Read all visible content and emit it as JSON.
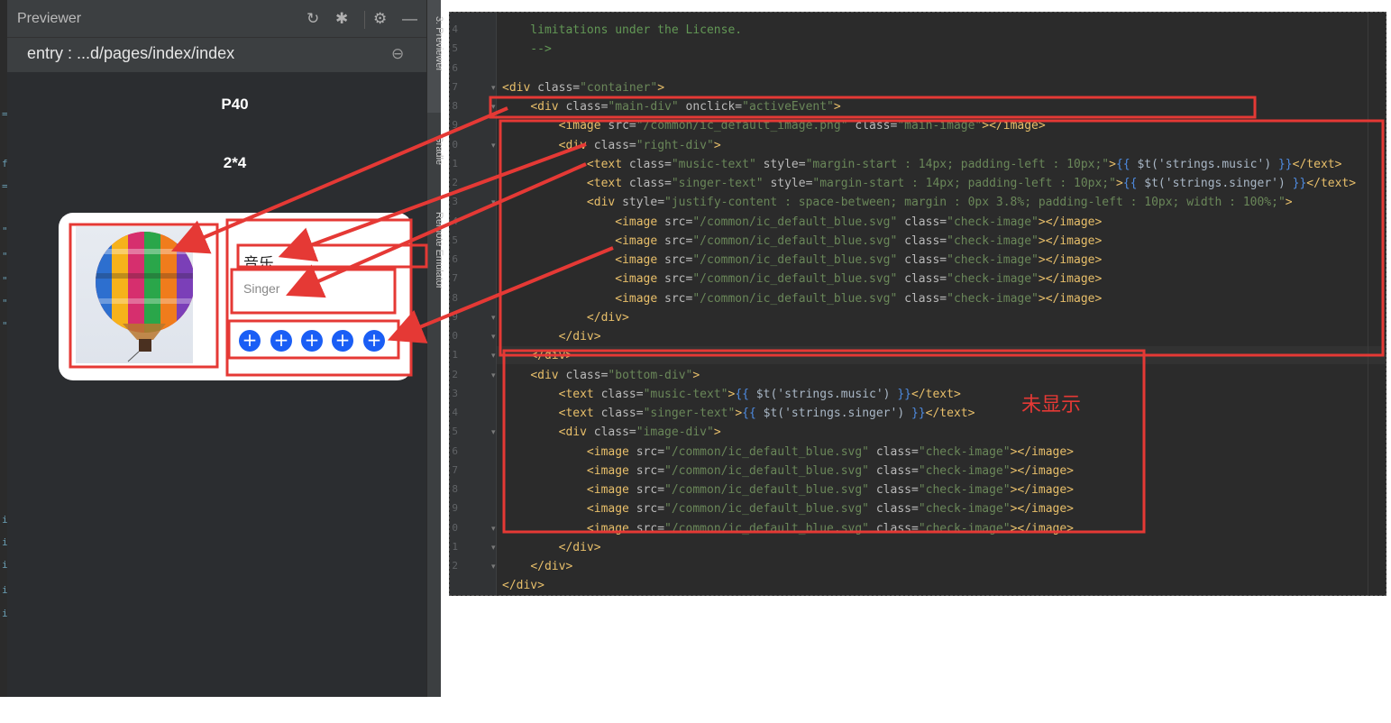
{
  "previewer": {
    "title": "Previewer",
    "entry": "entry : ...d/pages/index/index",
    "device_label": "P40",
    "size_label": "2*4",
    "card": {
      "music": "音乐",
      "singer": "Singer",
      "buttons": [
        "+",
        "+",
        "+",
        "+",
        "+"
      ]
    },
    "icons": {
      "refresh": "refresh-icon",
      "debug": "debug-bug-icon",
      "settings": "gear-icon",
      "minimize": "minimize-icon",
      "zoom_out": "zoom-out-icon"
    }
  },
  "side_tools": [
    "3: Previewer",
    "Gradle",
    "Remote Emulator"
  ],
  "editor": {
    "line_numbers": [
      "4",
      "5",
      "6",
      "7",
      "8",
      "9",
      "0",
      "1",
      "2",
      "3",
      "4",
      "5",
      "6",
      "7",
      "8",
      "9",
      "0",
      "1",
      "2",
      "3",
      "4",
      "5",
      "6",
      "7",
      "8",
      "9",
      "0",
      "1",
      "2"
    ],
    "lines": [
      [
        {
          "c": "t-com",
          "t": "    limitations under the License."
        }
      ],
      [
        {
          "c": "t-com",
          "t": "    -->"
        }
      ],
      [
        {
          "c": "t-txt",
          "t": ""
        }
      ],
      [
        {
          "c": "t-tag",
          "t": "<div "
        },
        {
          "c": "t-attr",
          "t": "class="
        },
        {
          "c": "t-val",
          "t": "\"container\""
        },
        {
          "c": "t-tag",
          "t": ">"
        }
      ],
      [
        {
          "c": "t-txt",
          "t": "    "
        },
        {
          "c": "t-tag",
          "t": "<div "
        },
        {
          "c": "t-attr",
          "t": "class="
        },
        {
          "c": "t-val",
          "t": "\"main-div\" "
        },
        {
          "c": "t-attr",
          "t": "onclick="
        },
        {
          "c": "t-val",
          "t": "\"activeEvent\""
        },
        {
          "c": "t-tag",
          "t": ">"
        }
      ],
      [
        {
          "c": "t-txt",
          "t": "        "
        },
        {
          "c": "t-tag",
          "t": "<image "
        },
        {
          "c": "t-attr",
          "t": "src="
        },
        {
          "c": "t-val",
          "t": "\"/common/ic_default_image.png\" "
        },
        {
          "c": "t-attr",
          "t": "class="
        },
        {
          "c": "t-val",
          "t": "\"main-image\""
        },
        {
          "c": "t-tag",
          "t": "></image>"
        }
      ],
      [
        {
          "c": "t-txt",
          "t": "        "
        },
        {
          "c": "t-tag",
          "t": "<div "
        },
        {
          "c": "t-attr",
          "t": "class="
        },
        {
          "c": "t-val",
          "t": "\"right-div\""
        },
        {
          "c": "t-tag",
          "t": ">"
        }
      ],
      [
        {
          "c": "t-txt",
          "t": "            "
        },
        {
          "c": "t-tag",
          "t": "<text "
        },
        {
          "c": "t-attr",
          "t": "class="
        },
        {
          "c": "t-val",
          "t": "\"music-text\" "
        },
        {
          "c": "t-attr",
          "t": "style="
        },
        {
          "c": "t-val",
          "t": "\"margin-start : 14px; padding-left : 10px;\""
        },
        {
          "c": "t-tag",
          "t": ">"
        },
        {
          "c": "t-br",
          "t": "{{ "
        },
        {
          "c": "t-txt",
          "t": "$t('strings.music') "
        },
        {
          "c": "t-br",
          "t": "}}"
        },
        {
          "c": "t-tag",
          "t": "</text>"
        }
      ],
      [
        {
          "c": "t-txt",
          "t": "            "
        },
        {
          "c": "t-tag",
          "t": "<text "
        },
        {
          "c": "t-attr",
          "t": "class="
        },
        {
          "c": "t-val",
          "t": "\"singer-text\" "
        },
        {
          "c": "t-attr",
          "t": "style="
        },
        {
          "c": "t-val",
          "t": "\"margin-start : 14px; padding-left : 10px;\""
        },
        {
          "c": "t-tag",
          "t": ">"
        },
        {
          "c": "t-br",
          "t": "{{ "
        },
        {
          "c": "t-txt",
          "t": "$t('strings.singer') "
        },
        {
          "c": "t-br",
          "t": "}}"
        },
        {
          "c": "t-tag",
          "t": "</text>"
        }
      ],
      [
        {
          "c": "t-txt",
          "t": "            "
        },
        {
          "c": "t-tag",
          "t": "<div "
        },
        {
          "c": "t-attr",
          "t": "style="
        },
        {
          "c": "t-val",
          "t": "\"justify-content : space-between; margin : 0px 3.8%; padding-left : 10px; width : 100%;\""
        },
        {
          "c": "t-tag",
          "t": ">"
        }
      ],
      [
        {
          "c": "t-txt",
          "t": "                "
        },
        {
          "c": "t-tag",
          "t": "<image "
        },
        {
          "c": "t-attr",
          "t": "src="
        },
        {
          "c": "t-val",
          "t": "\"/common/ic_default_blue.svg\" "
        },
        {
          "c": "t-attr",
          "t": "class="
        },
        {
          "c": "t-val",
          "t": "\"check-image\""
        },
        {
          "c": "t-tag",
          "t": "></image>"
        }
      ],
      [
        {
          "c": "t-txt",
          "t": "                "
        },
        {
          "c": "t-tag",
          "t": "<image "
        },
        {
          "c": "t-attr",
          "t": "src="
        },
        {
          "c": "t-val",
          "t": "\"/common/ic_default_blue.svg\" "
        },
        {
          "c": "t-attr",
          "t": "class="
        },
        {
          "c": "t-val",
          "t": "\"check-image\""
        },
        {
          "c": "t-tag",
          "t": "></image>"
        }
      ],
      [
        {
          "c": "t-txt",
          "t": "                "
        },
        {
          "c": "t-tag",
          "t": "<image "
        },
        {
          "c": "t-attr",
          "t": "src="
        },
        {
          "c": "t-val",
          "t": "\"/common/ic_default_blue.svg\" "
        },
        {
          "c": "t-attr",
          "t": "class="
        },
        {
          "c": "t-val",
          "t": "\"check-image\""
        },
        {
          "c": "t-tag",
          "t": "></image>"
        }
      ],
      [
        {
          "c": "t-txt",
          "t": "                "
        },
        {
          "c": "t-tag",
          "t": "<image "
        },
        {
          "c": "t-attr",
          "t": "src="
        },
        {
          "c": "t-val",
          "t": "\"/common/ic_default_blue.svg\" "
        },
        {
          "c": "t-attr",
          "t": "class="
        },
        {
          "c": "t-val",
          "t": "\"check-image\""
        },
        {
          "c": "t-tag",
          "t": "></image>"
        }
      ],
      [
        {
          "c": "t-txt",
          "t": "                "
        },
        {
          "c": "t-tag",
          "t": "<image "
        },
        {
          "c": "t-attr",
          "t": "src="
        },
        {
          "c": "t-val",
          "t": "\"/common/ic_default_blue.svg\" "
        },
        {
          "c": "t-attr",
          "t": "class="
        },
        {
          "c": "t-val",
          "t": "\"check-image\""
        },
        {
          "c": "t-tag",
          "t": "></image>"
        }
      ],
      [
        {
          "c": "t-txt",
          "t": "            "
        },
        {
          "c": "t-tag",
          "t": "</div>"
        }
      ],
      [
        {
          "c": "t-txt",
          "t": "        "
        },
        {
          "c": "t-tag",
          "t": "</div>"
        }
      ],
      [
        {
          "c": "t-txt",
          "t": "    "
        },
        {
          "c": "t-tag",
          "t": "</div>"
        }
      ],
      [
        {
          "c": "t-txt",
          "t": "    "
        },
        {
          "c": "t-tag",
          "t": "<div "
        },
        {
          "c": "t-attr",
          "t": "class="
        },
        {
          "c": "t-val",
          "t": "\"bottom-div\""
        },
        {
          "c": "t-tag",
          "t": ">"
        }
      ],
      [
        {
          "c": "t-txt",
          "t": "        "
        },
        {
          "c": "t-tag",
          "t": "<text "
        },
        {
          "c": "t-attr",
          "t": "class="
        },
        {
          "c": "t-val",
          "t": "\"music-text\""
        },
        {
          "c": "t-tag",
          "t": ">"
        },
        {
          "c": "t-br",
          "t": "{{ "
        },
        {
          "c": "t-txt",
          "t": "$t('strings.music') "
        },
        {
          "c": "t-br",
          "t": "}}"
        },
        {
          "c": "t-tag",
          "t": "</text>"
        }
      ],
      [
        {
          "c": "t-txt",
          "t": "        "
        },
        {
          "c": "t-tag",
          "t": "<text "
        },
        {
          "c": "t-attr",
          "t": "class="
        },
        {
          "c": "t-val",
          "t": "\"singer-text\""
        },
        {
          "c": "t-tag",
          "t": ">"
        },
        {
          "c": "t-br",
          "t": "{{ "
        },
        {
          "c": "t-txt",
          "t": "$t('strings.singer') "
        },
        {
          "c": "t-br",
          "t": "}}"
        },
        {
          "c": "t-tag",
          "t": "</text>"
        }
      ],
      [
        {
          "c": "t-txt",
          "t": "        "
        },
        {
          "c": "t-tag",
          "t": "<div "
        },
        {
          "c": "t-attr",
          "t": "class="
        },
        {
          "c": "t-val",
          "t": "\"image-div\""
        },
        {
          "c": "t-tag",
          "t": ">"
        }
      ],
      [
        {
          "c": "t-txt",
          "t": "            "
        },
        {
          "c": "t-tag",
          "t": "<image "
        },
        {
          "c": "t-attr",
          "t": "src="
        },
        {
          "c": "t-val",
          "t": "\"/common/ic_default_blue.svg\" "
        },
        {
          "c": "t-attr",
          "t": "class="
        },
        {
          "c": "t-val",
          "t": "\"check-image\""
        },
        {
          "c": "t-tag",
          "t": "></image>"
        }
      ],
      [
        {
          "c": "t-txt",
          "t": "            "
        },
        {
          "c": "t-tag",
          "t": "<image "
        },
        {
          "c": "t-attr",
          "t": "src="
        },
        {
          "c": "t-val",
          "t": "\"/common/ic_default_blue.svg\" "
        },
        {
          "c": "t-attr",
          "t": "class="
        },
        {
          "c": "t-val",
          "t": "\"check-image\""
        },
        {
          "c": "t-tag",
          "t": "></image>"
        }
      ],
      [
        {
          "c": "t-txt",
          "t": "            "
        },
        {
          "c": "t-tag",
          "t": "<image "
        },
        {
          "c": "t-attr",
          "t": "src="
        },
        {
          "c": "t-val",
          "t": "\"/common/ic_default_blue.svg\" "
        },
        {
          "c": "t-attr",
          "t": "class="
        },
        {
          "c": "t-val",
          "t": "\"check-image\""
        },
        {
          "c": "t-tag",
          "t": "></image>"
        }
      ],
      [
        {
          "c": "t-txt",
          "t": "            "
        },
        {
          "c": "t-tag",
          "t": "<image "
        },
        {
          "c": "t-attr",
          "t": "src="
        },
        {
          "c": "t-val",
          "t": "\"/common/ic_default_blue.svg\" "
        },
        {
          "c": "t-attr",
          "t": "class="
        },
        {
          "c": "t-val",
          "t": "\"check-image\""
        },
        {
          "c": "t-tag",
          "t": "></image>"
        }
      ],
      [
        {
          "c": "t-txt",
          "t": "            "
        },
        {
          "c": "t-tag",
          "t": "<image "
        },
        {
          "c": "t-attr",
          "t": "src="
        },
        {
          "c": "t-val",
          "t": "\"/common/ic_default_blue.svg\" "
        },
        {
          "c": "t-attr",
          "t": "class="
        },
        {
          "c": "t-val",
          "t": "\"check-image\""
        },
        {
          "c": "t-tag",
          "t": "></image>"
        }
      ],
      [
        {
          "c": "t-txt",
          "t": "        "
        },
        {
          "c": "t-tag",
          "t": "</div>"
        }
      ],
      [
        {
          "c": "t-txt",
          "t": "    "
        },
        {
          "c": "t-tag",
          "t": "</div>"
        }
      ],
      [
        {
          "c": "t-tag",
          "t": "</div>"
        }
      ]
    ]
  },
  "annotation": {
    "label": "未显示",
    "color": "#e53935"
  }
}
